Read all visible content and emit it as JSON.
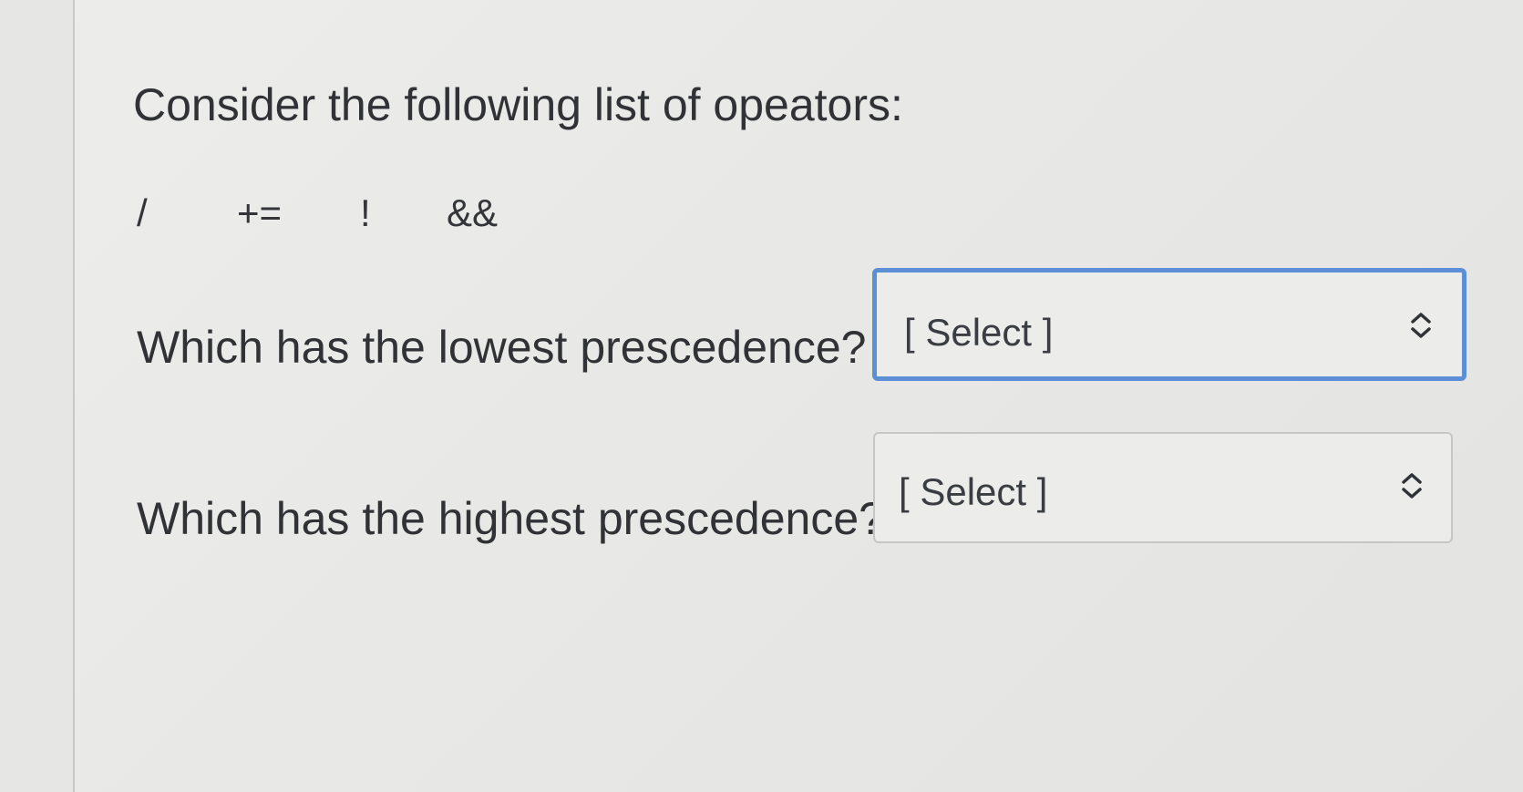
{
  "question": {
    "text": "Consider the following list of opeators:",
    "operators": [
      "/",
      "+=",
      "!",
      "&&"
    ]
  },
  "prompts": [
    {
      "label": "Which has the lowest prescedence?",
      "select_value": "[ Select ]",
      "focused": true
    },
    {
      "label": "Which has the highest prescedence?",
      "select_value": "[ Select ]",
      "focused": false
    }
  ],
  "colors": {
    "focus_border": "#5d8fd6",
    "default_border": "#c6c6c4",
    "text": "#303236"
  }
}
